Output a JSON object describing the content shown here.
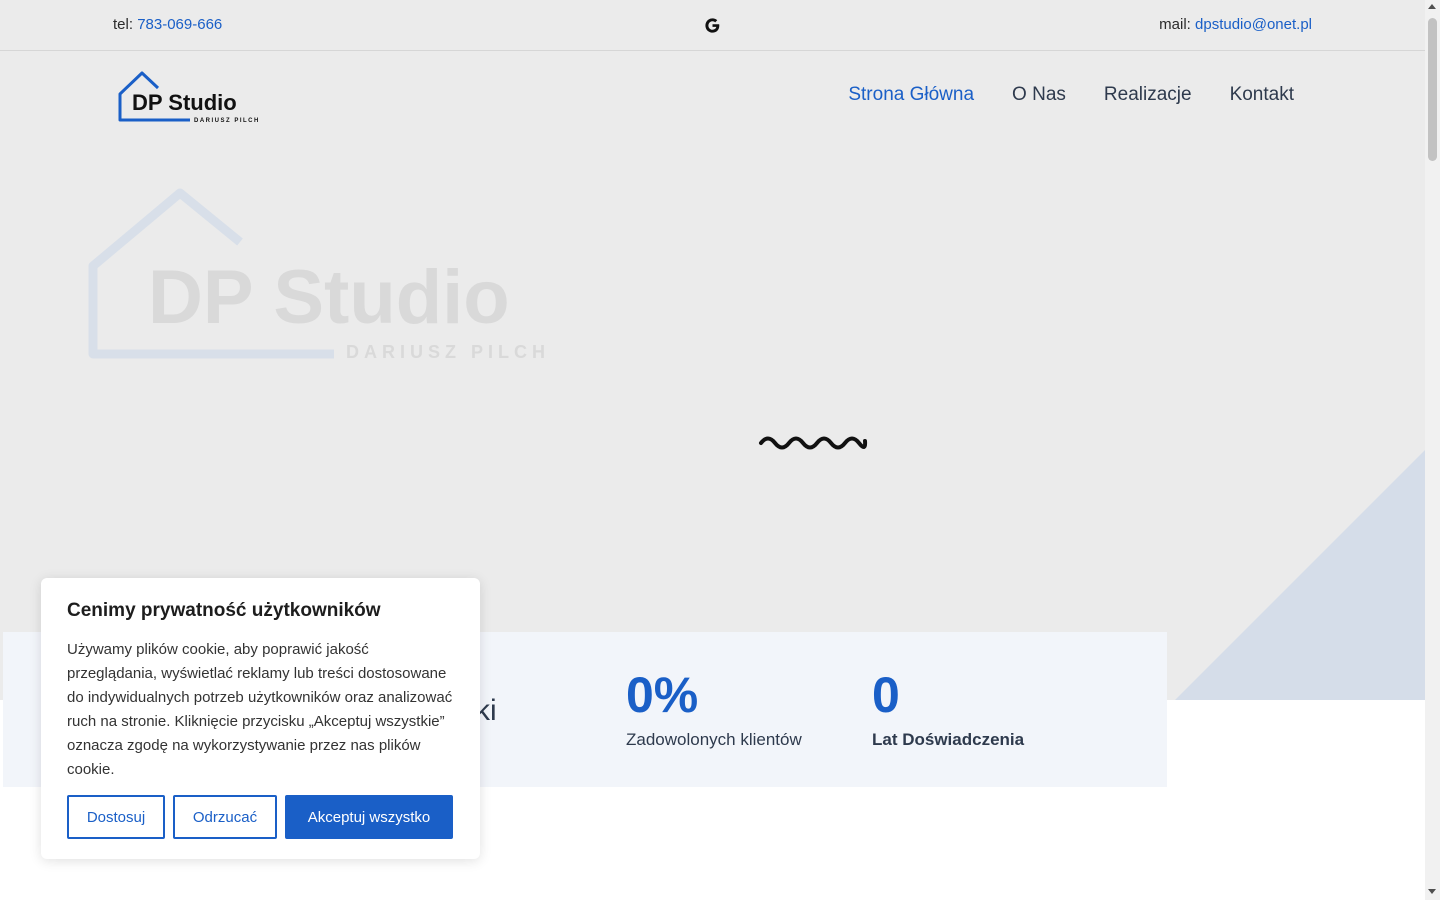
{
  "topbar": {
    "tel_label": "tel:",
    "tel_value": "783-069-666",
    "mail_label": "mail:",
    "mail_value": "dpstudio@onet.pl",
    "google_icon": "google-icon"
  },
  "logo": {
    "name": "DP Studio",
    "tagline": "DARIUSZ PILCH"
  },
  "nav": {
    "items": [
      {
        "label": "Strona Główna",
        "active": true
      },
      {
        "label": "O Nas",
        "active": false
      },
      {
        "label": "Realizacje",
        "active": false
      },
      {
        "label": "Kontakt",
        "active": false
      }
    ]
  },
  "hero": {
    "watermark_name": "DP Studio",
    "watermark_tagline": "DARIUSZ PILCH",
    "loader_icon": "wave-loader-icon"
  },
  "stats": {
    "partial_text": "ki",
    "items": [
      {
        "value": "0%",
        "label": "Zadowolonych klientów"
      },
      {
        "value": "0",
        "label": "Lat Doświadczenia"
      }
    ]
  },
  "cookie": {
    "title": "Cenimy prywatność użytkowników",
    "body": "Używamy plików cookie, aby poprawić jakość przeglądania, wyświetlać reklamy lub treści dostosowane do indywidualnych potrzeb użytkowników oraz analizować ruch na stronie. Kliknięcie przycisku „Akceptuj wszystkie” oznacza zgodę na wykorzystywanie przez nas plików cookie.",
    "customize_label": "Dostosuj",
    "reject_label": "Odrzucać",
    "accept_label": "Akceptuj wszystko"
  },
  "colors": {
    "accent": "#1a5fc7",
    "hero_bg": "#ebebeb",
    "triangle": "#d5dde9",
    "stats_bg": "#f2f5fa"
  }
}
